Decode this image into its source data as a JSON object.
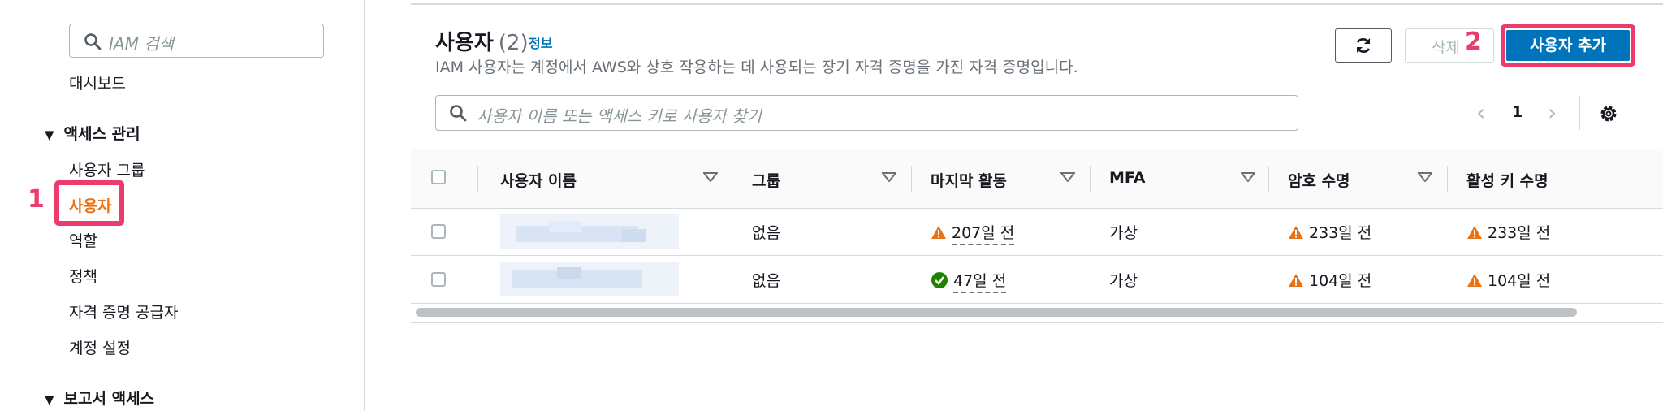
{
  "sidebar": {
    "search_placeholder": "IAM 검색",
    "dashboard": "대시보드",
    "access_mgmt_section": "액세스 관리",
    "items": [
      {
        "label": "사용자 그룹"
      },
      {
        "label": "사용자"
      },
      {
        "label": "역할"
      },
      {
        "label": "정책"
      },
      {
        "label": "자격 증명 공급자"
      },
      {
        "label": "계정 설정"
      }
    ],
    "report_section": "보고서 액세스",
    "step1": "1"
  },
  "header": {
    "title": "사용자",
    "count": "(2)",
    "info": "정보",
    "description": "IAM 사용자는 계정에서 AWS와 상호 작용하는 데 사용되는 장기 자격 증명을 가진 자격 증명입니다.",
    "delete_label": "삭제",
    "add_user_label": "사용자 추가",
    "step2": "2"
  },
  "search": {
    "placeholder": "사용자 이름 또는 액세스 키로 사용자 찾기"
  },
  "pagination": {
    "prev": "‹",
    "page": "1",
    "next": "›"
  },
  "table": {
    "columns": [
      "사용자 이름",
      "그룹",
      "마지막 활동",
      "MFA",
      "암호 수명",
      "활성 키 수명"
    ],
    "rows": [
      {
        "group": "없음",
        "last_activity": "207일 전",
        "last_activity_status": "warning",
        "mfa": "가상",
        "password_age": "233일 전",
        "key_age": "233일 전"
      },
      {
        "group": "없음",
        "last_activity": "47일 전",
        "last_activity_status": "ok",
        "mfa": "가상",
        "password_age": "104일 전",
        "key_age": "104일 전"
      }
    ]
  },
  "colors": {
    "accent": "#0073bb",
    "highlight": "#ec3c6f",
    "active_nav": "#ec7211",
    "warning": "#ec7211",
    "success": "#1d8102"
  }
}
